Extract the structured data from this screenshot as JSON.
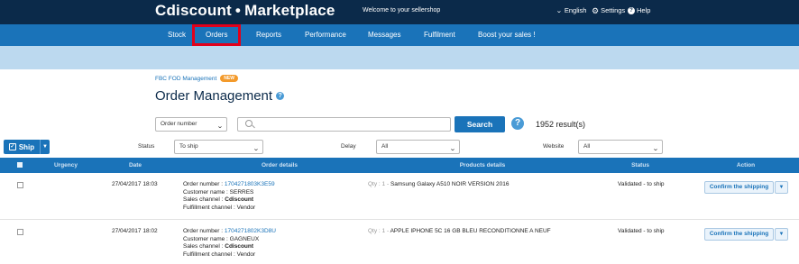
{
  "header": {
    "brand": "Cdiscount",
    "brand_sep": "•",
    "brand_suffix": "Marketplace",
    "welcome": "Welcome to your sellershop",
    "language": "English",
    "settings": "Settings",
    "help": "Help"
  },
  "nav": {
    "items": [
      {
        "label": "Stock"
      },
      {
        "label": "Orders"
      },
      {
        "label": "Reports"
      },
      {
        "label": "Performance"
      },
      {
        "label": "Messages"
      },
      {
        "label": "Fulfilment"
      },
      {
        "label": "Boost your sales !"
      }
    ],
    "active": "Orders",
    "highlight_color": "#e2001a"
  },
  "breadcrumb": {
    "label": "FBC FOD Management",
    "badge": "NEW"
  },
  "page": {
    "title": "Order Management"
  },
  "search": {
    "field_select": "Order number",
    "input_value": "",
    "button": "Search",
    "results": "1952 result(s)"
  },
  "filters": {
    "ship_button": "Ship",
    "status_label": "Status",
    "status_value": "To ship",
    "delay_label": "Delay",
    "delay_value": "All",
    "website_label": "Website",
    "website_value": "All"
  },
  "table": {
    "columns": [
      "Urgency",
      "Date",
      "Order details",
      "Products details",
      "Status",
      "Action"
    ],
    "rows": [
      {
        "date": "27/04/2017 18:03",
        "order_number_label": "Order number :",
        "order_number": "1704271803K3E59",
        "customer": "Customer name : SERRES",
        "sales_channel_label": "Sales channel :",
        "sales_channel": "Cdiscount",
        "fulfilment": "Fulfillment channel : Vendor",
        "qty": "Qty : 1 -",
        "product": "Samsung Galaxy A510 NOIR VERSION 2016",
        "status": "Validated - to ship",
        "action": "Confirm the shipping"
      },
      {
        "date": "27/04/2017 18:02",
        "order_number_label": "Order number :",
        "order_number": "1704271802K3D8U",
        "customer": "Customer name : GAGNEUX",
        "sales_channel_label": "Sales channel :",
        "sales_channel": "Cdiscount",
        "fulfilment": "Fulfillment channel : Vendor",
        "qty": "Qty : 1 -",
        "product": "APPLE IPHONE 5C 16 GB BLEU RECONDITIONNE A NEUF",
        "status": "Validated - to ship",
        "action": "Confirm the shipping"
      }
    ]
  },
  "colors": {
    "header_bg": "#0b2a4a",
    "nav_bg": "#1a73b9",
    "subbar_bg": "#bcd9ef"
  }
}
